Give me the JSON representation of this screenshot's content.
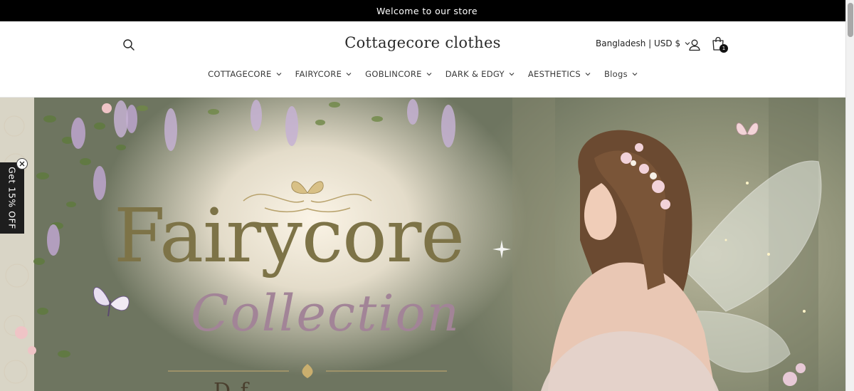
{
  "announcement": {
    "text": "Welcome to our store"
  },
  "header": {
    "logo": "Cottagecore clothes",
    "currency": "Bangladesh | USD $",
    "cart_count": "1",
    "icons": {
      "search": "search-icon",
      "account": "user-icon",
      "cart": "shopping-bag-icon"
    }
  },
  "nav": {
    "items": [
      {
        "label": "COTTAGECORE"
      },
      {
        "label": "FAIRYCORE"
      },
      {
        "label": "GOBLINCORE"
      },
      {
        "label": "DARK & EDGY"
      },
      {
        "label": "AESTHETICS"
      },
      {
        "label": "Blogs"
      }
    ]
  },
  "hero": {
    "title": "Fairycore",
    "subtitle": "Collection",
    "tagline_partial": "D              f"
  },
  "discount": {
    "label": "Get 15% OFF"
  },
  "colors": {
    "announcement_bg": "#000000",
    "hero_title": "#7d7347",
    "hero_subtitle": "#a28497",
    "discount_bg": "#1e1e1e"
  }
}
